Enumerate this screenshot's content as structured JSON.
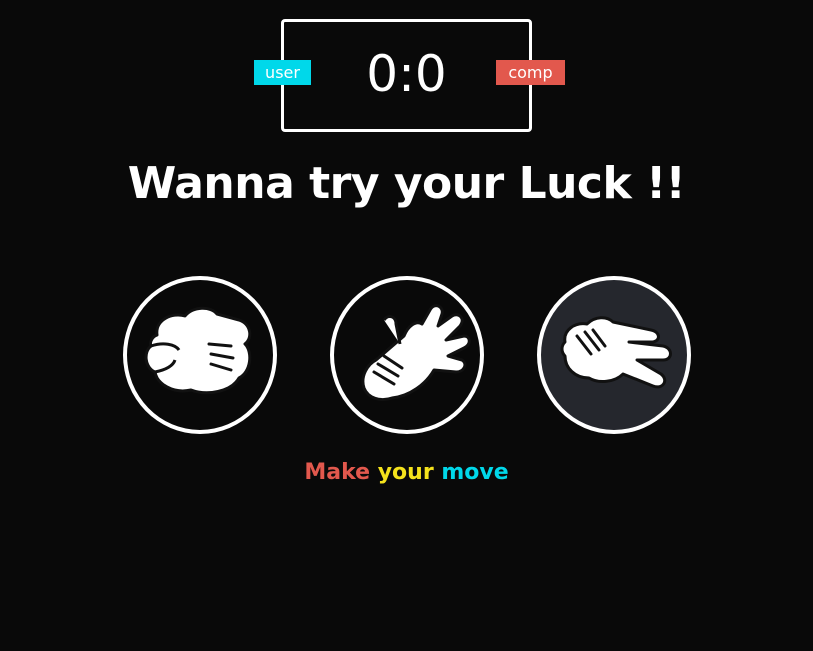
{
  "scoreboard": {
    "score": "0:0",
    "user_label": "user",
    "comp_label": "comp",
    "user_color": "#00d8ea",
    "comp_color": "#e2584d"
  },
  "headline": "Wanna try your Luck !!",
  "choices": [
    {
      "icon": "rock-hand-icon"
    },
    {
      "icon": "paper-hand-icon"
    },
    {
      "icon": "scissors-hand-icon"
    }
  ],
  "message": {
    "words": [
      "Make",
      "your",
      "move"
    ],
    "colors": [
      "#e2584d",
      "#f4e21c",
      "#00d8ea"
    ]
  }
}
